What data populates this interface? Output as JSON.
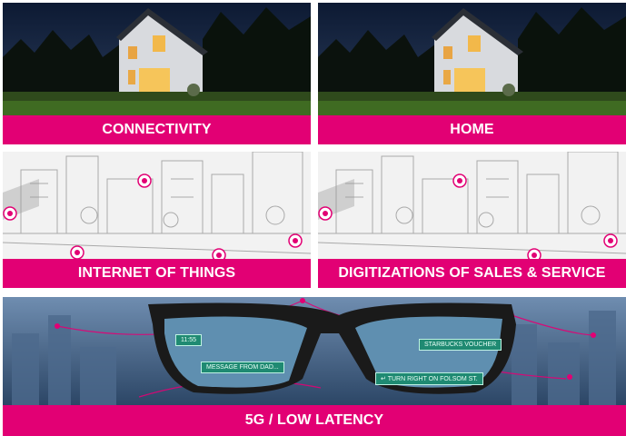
{
  "tiles": [
    {
      "id": "connectivity",
      "label": "CONNECTIVITY"
    },
    {
      "id": "home",
      "label": "HOME"
    },
    {
      "id": "iot",
      "label": "INTERNET OF THINGS"
    },
    {
      "id": "sales",
      "label": "DIGITIZATIONS OF SALES & SERVICE"
    },
    {
      "id": "5g",
      "label": "5G / LOW LATENCY"
    }
  ],
  "hud": {
    "time": "11:55",
    "message": "MESSAGE FROM DAD...",
    "voucher": "STARBUCKS VOUCHER",
    "nav": "TURN RIGHT ON FOLSOM ST."
  },
  "colors": {
    "brand": "#e20074",
    "hud": "#1f8a72"
  }
}
